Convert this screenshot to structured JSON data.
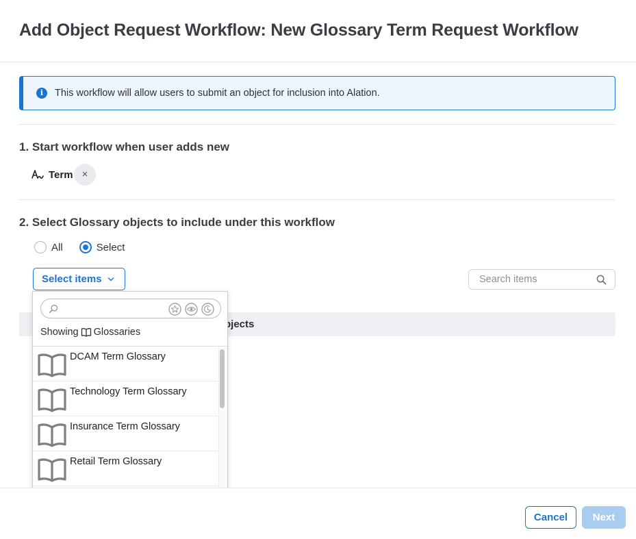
{
  "dialog": {
    "title": "Add Object Request Workflow: New Glossary Term Request Workflow"
  },
  "info_banner": {
    "icon": "info-icon",
    "text": "This workflow will allow users to submit an object for inclusion into Alation."
  },
  "step1": {
    "title": "1. Start workflow when user adds new",
    "chip": {
      "icon": "term-icon",
      "label": "Term",
      "remove_glyph": "×"
    }
  },
  "step2": {
    "title": "2. Select Glossary objects to include under this workflow",
    "radios": [
      {
        "label": "All",
        "checked": false
      },
      {
        "label": "Select",
        "checked": true
      }
    ],
    "select_button": "Select items",
    "search": {
      "placeholder": "Search items",
      "value": ""
    },
    "table_header_visible_text": "bjects"
  },
  "dropdown": {
    "search_placeholder": "",
    "filter_icons": [
      "star-icon",
      "eye-icon",
      "clock-icon"
    ],
    "showing_prefix": "Showing",
    "showing_type": "Glossaries",
    "items": [
      {
        "label": "DCAM Term Glossary",
        "icon": "book-icon"
      },
      {
        "label": "Technology Term Glossary",
        "icon": "book-icon"
      },
      {
        "label": "Insurance Term Glossary",
        "icon": "book-icon"
      },
      {
        "label": "Retail Term Glossary",
        "icon": "book-icon"
      }
    ]
  },
  "footer": {
    "cancel_label": "Cancel",
    "next_label": "Next",
    "next_enabled": false
  },
  "colors": {
    "accent": "#1a74d2",
    "banner_bg": "#eef5fd",
    "next_disabled": "#a8cdf1"
  }
}
